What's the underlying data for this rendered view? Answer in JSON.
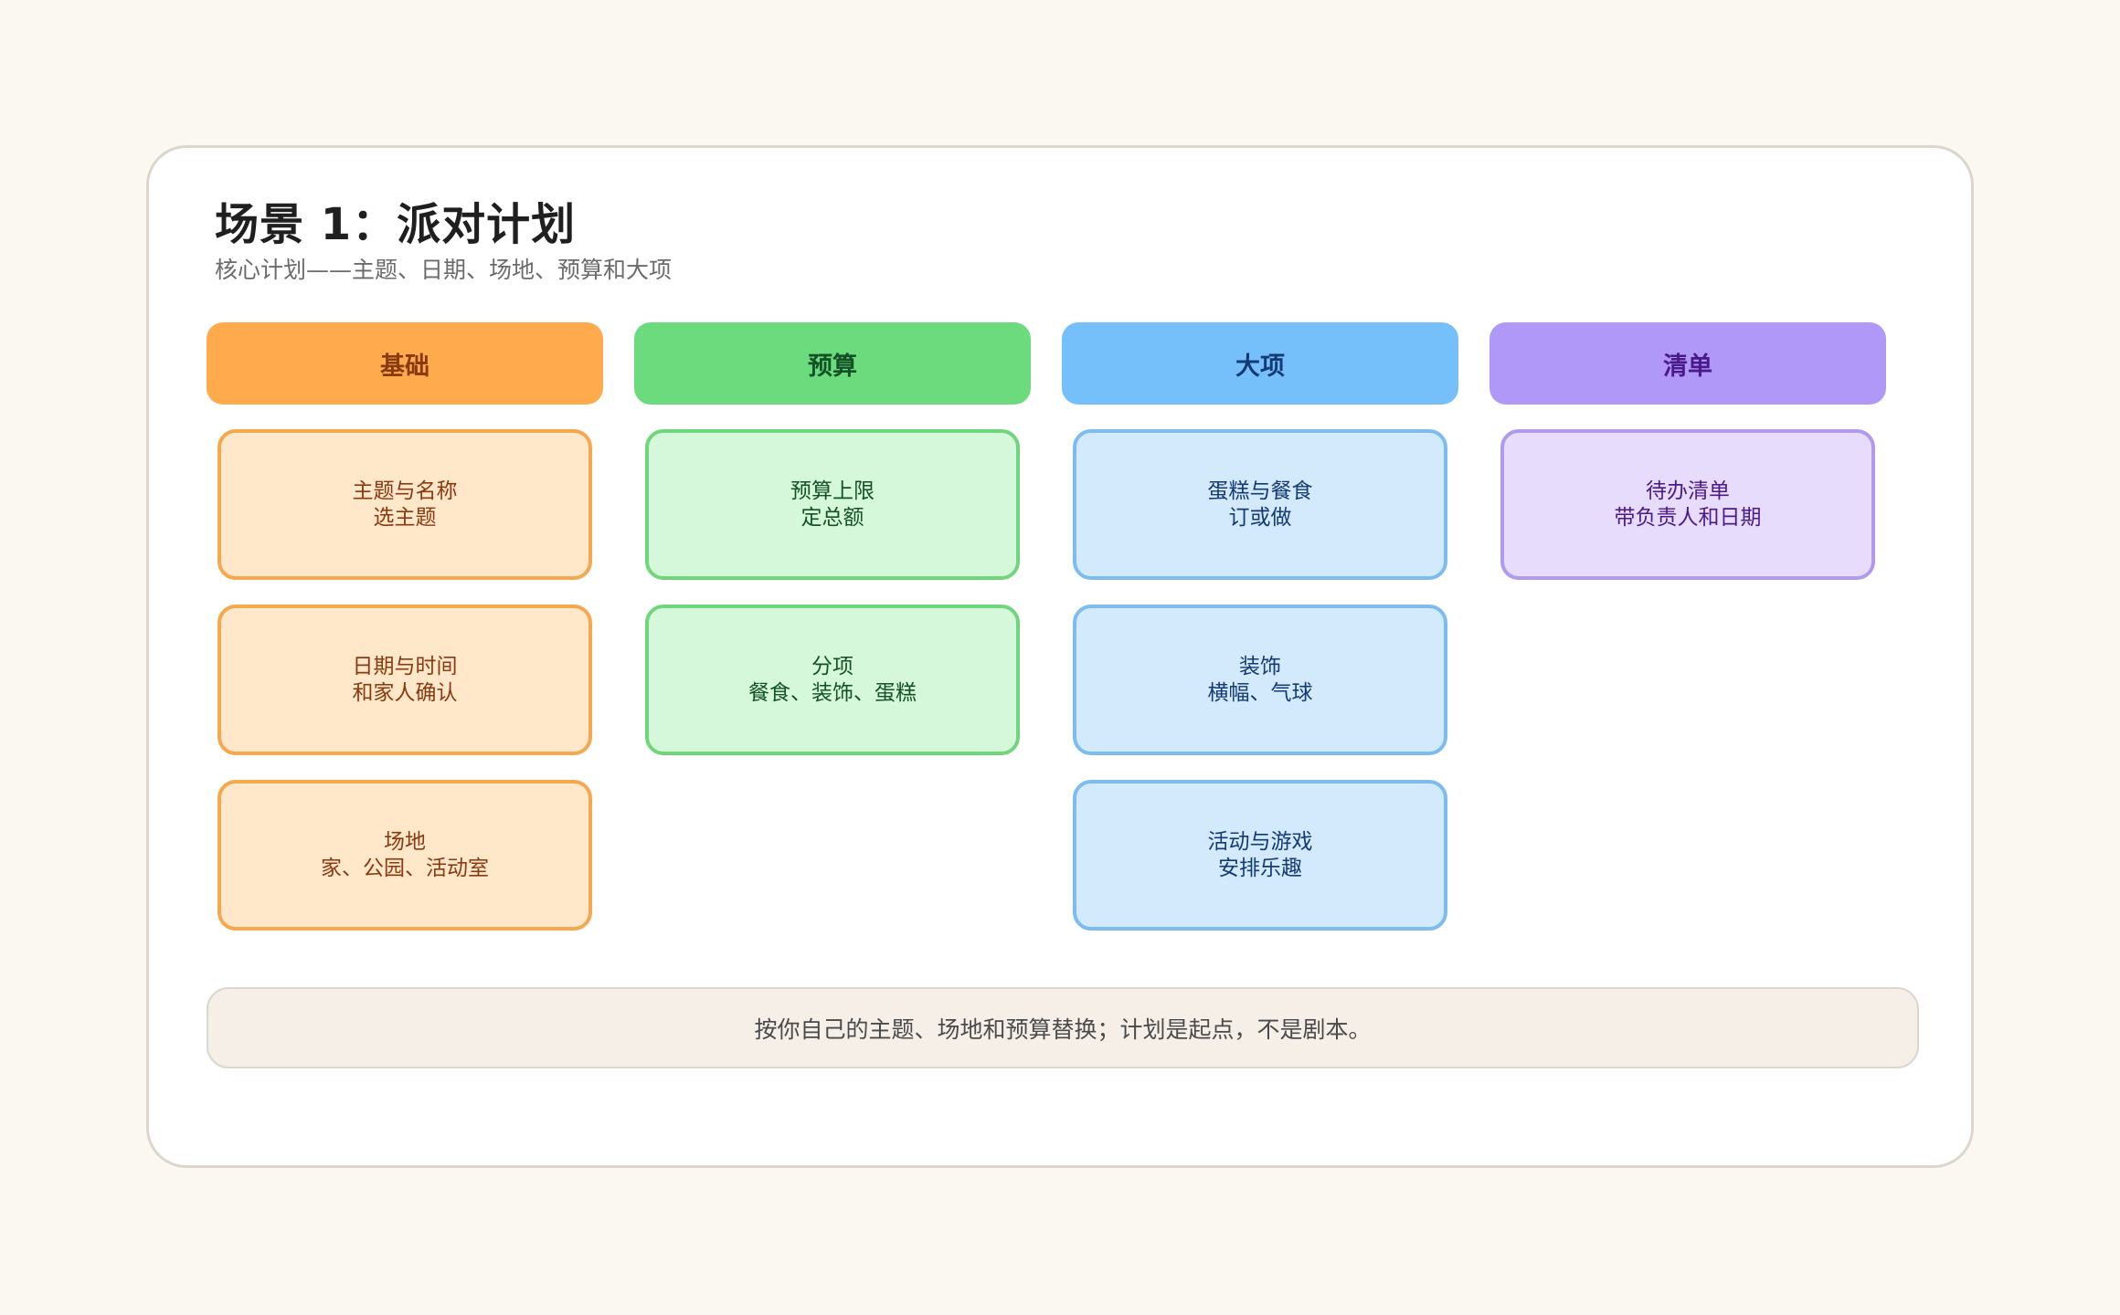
{
  "title": "场景 1：派对计划",
  "subtitle": "核心计划——主题、日期、场地、预算和大项",
  "columns": [
    {
      "header": "基础",
      "header_bg": "#ffaa4d",
      "header_fg": "#8a3a10",
      "node_bg": "#ffe7c9",
      "node_border": "#f5a84e",
      "node_fg": "#8a3a10",
      "nodes": [
        {
          "line1": "主题与名称",
          "line2": "选主题"
        },
        {
          "line1": "日期与时间",
          "line2": "和家人确认"
        },
        {
          "line1": "场地",
          "line2": "家、公园、活动室"
        }
      ]
    },
    {
      "header": "预算",
      "header_bg": "#6bdb7d",
      "header_fg": "#145226",
      "node_bg": "#d5f8da",
      "node_border": "#6fd67d",
      "node_fg": "#145226",
      "nodes": [
        {
          "line1": "预算上限",
          "line2": "定总额"
        },
        {
          "line1": "分项",
          "line2": "餐食、装饰、蛋糕"
        }
      ]
    },
    {
      "header": "大项",
      "header_bg": "#75c0fb",
      "header_fg": "#143a75",
      "node_bg": "#d3eafd",
      "node_border": "#7cbcef",
      "node_fg": "#143a75",
      "nodes": [
        {
          "line1": "蛋糕与餐食",
          "line2": "订或做"
        },
        {
          "line1": "装饰",
          "line2": "横幅、气球"
        },
        {
          "line1": "活动与游戏",
          "line2": "安排乐趣"
        }
      ]
    },
    {
      "header": "清单",
      "header_bg": "#b098f8",
      "header_fg": "#4a1a8a",
      "node_bg": "#e8dcfd",
      "node_border": "#b09af0",
      "node_fg": "#4a1a8a",
      "nodes": [
        {
          "line1": "待办清单",
          "line2": "带负责人和日期"
        }
      ]
    }
  ],
  "footer": "按你自己的主题、场地和预算替换；计划是起点，不是剧本。"
}
